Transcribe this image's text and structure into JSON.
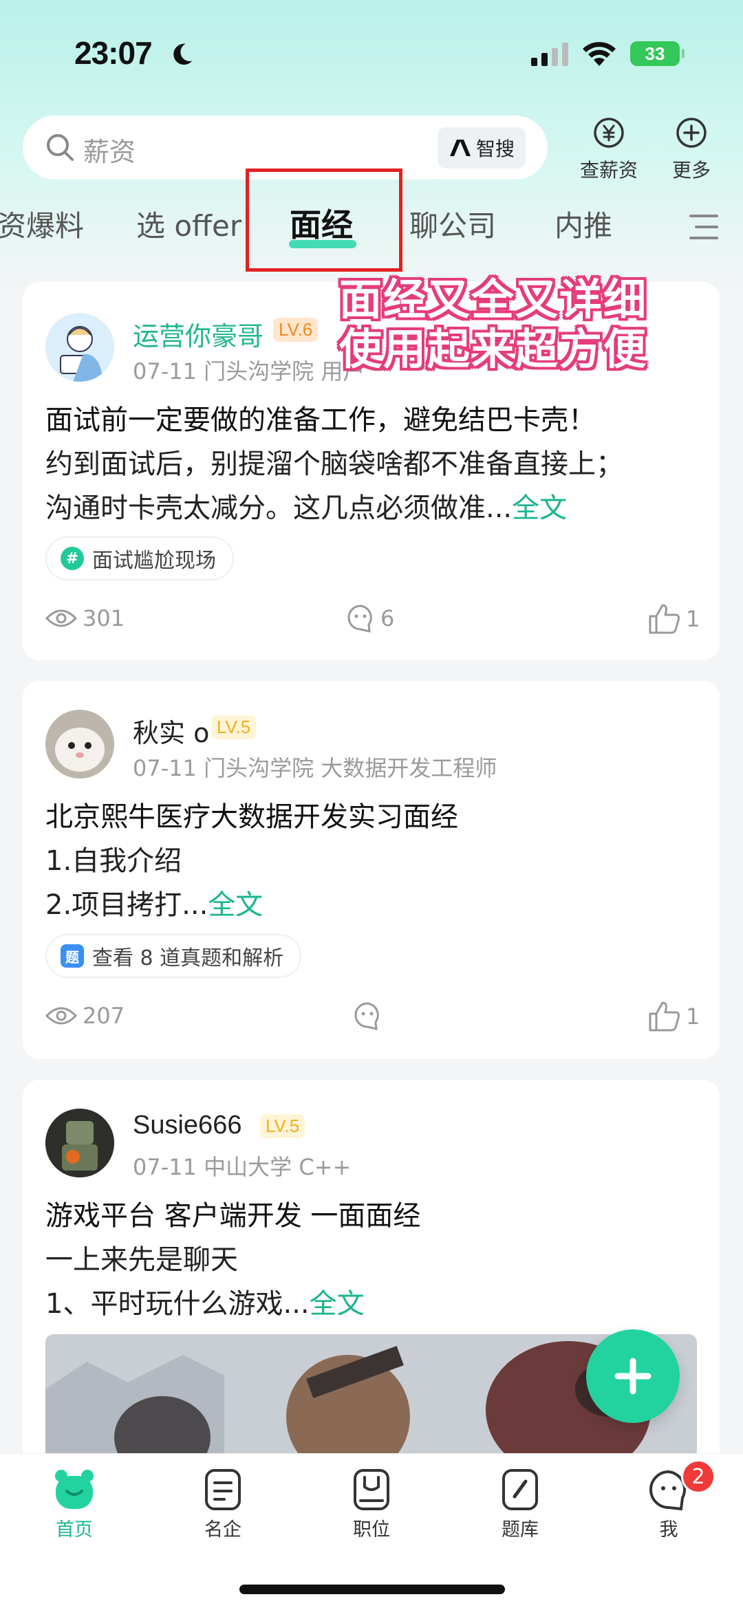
{
  "status_bar": {
    "time": "23:07",
    "battery": "33"
  },
  "search": {
    "placeholder": "薪资",
    "ai_search_label": "智搜"
  },
  "top_actions": {
    "salary_label": "查薪资",
    "more_label": "更多"
  },
  "tabs": [
    {
      "label": "资爆料"
    },
    {
      "label": "选 offer"
    },
    {
      "label": "面经",
      "active": true
    },
    {
      "label": "聊公司"
    },
    {
      "label": "内推"
    }
  ],
  "promo": {
    "line1": "面经又全又详细",
    "line2": "使用起来超方便"
  },
  "posts": [
    {
      "user": "运营你豪哥",
      "level": "LV.6",
      "meta": "07-11 门头沟学院 用户",
      "title": "面试前一定要做的准备工作，避免结巴卡壳！",
      "lines": [
        "约到面试后，别提溜个脑袋啥都不准备直接上；",
        "沟通时卡壳太减分。这几点必须做准..."
      ],
      "more": "全文",
      "tag": "面试尴尬现场",
      "views": "301",
      "comments": "6",
      "likes": "1"
    },
    {
      "user": "秋实 o",
      "level": "LV.5",
      "meta": "07-11 门头沟学院 大数据开发工程师",
      "title": "北京熙牛医疗大数据开发实习面经",
      "lines": [
        "1.自我介绍",
        "2.项目拷打..."
      ],
      "more": "全文",
      "tag": "查看 8 道真题和解析",
      "tag_icon": "题",
      "views": "207",
      "comments": "",
      "likes": "1"
    },
    {
      "user": "Susie666",
      "level": "LV.5",
      "meta": "07-11 中山大学 C++",
      "title": "游戏平台 客户端开发 一面面经",
      "lines": [
        "一上来先是聊天",
        "1、平时玩什么游戏..."
      ],
      "more": "全文"
    }
  ],
  "bottom_nav": [
    {
      "label": "首页",
      "icon": "home-icon",
      "active": true
    },
    {
      "label": "名企",
      "icon": "companies-icon"
    },
    {
      "label": "职位",
      "icon": "jobs-icon"
    },
    {
      "label": "题库",
      "icon": "question-bank-icon"
    },
    {
      "label": "我",
      "icon": "profile-icon"
    }
  ],
  "notification_count": "2",
  "colors": {
    "accent": "#1ab58f",
    "highlight_box": "#e12222",
    "promo_stroke": "#e53c7a"
  }
}
